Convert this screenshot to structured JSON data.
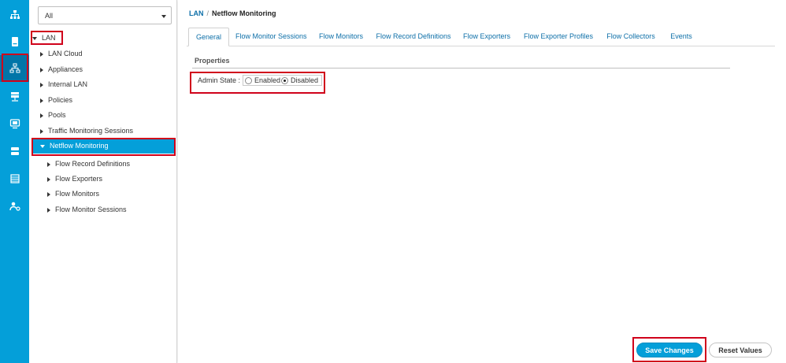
{
  "rail": {
    "icons": [
      "network-icon",
      "server-icon",
      "lan-icon",
      "san-icon",
      "vm-icon",
      "storage-icon",
      "chassis-icon",
      "admin-icon"
    ],
    "active": "lan-icon"
  },
  "tree": {
    "filter": {
      "value": "All"
    },
    "items": [
      {
        "label": "LAN",
        "arrow": "down"
      },
      {
        "label": "LAN Cloud",
        "arrow": "right"
      },
      {
        "label": "Appliances",
        "arrow": "right"
      },
      {
        "label": "Internal LAN",
        "arrow": "right"
      },
      {
        "label": "Policies",
        "arrow": "right"
      },
      {
        "label": "Pools",
        "arrow": "right"
      },
      {
        "label": "Traffic Monitoring Sessions",
        "arrow": "right"
      },
      {
        "label": "Netflow Monitoring",
        "arrow": "down",
        "selected": true
      },
      {
        "label": "Flow Record Definitions",
        "arrow": "right"
      },
      {
        "label": "Flow Exporters",
        "arrow": "right"
      },
      {
        "label": "Flow Monitors",
        "arrow": "right"
      },
      {
        "label": "Flow Monitor Sessions",
        "arrow": "right"
      }
    ]
  },
  "breadcrumb": {
    "root": "LAN",
    "separator": "/",
    "current": "Netflow Monitoring"
  },
  "tabs": [
    {
      "label": "General",
      "active": true
    },
    {
      "label": "Flow Monitor Sessions"
    },
    {
      "label": "Flow Monitors"
    },
    {
      "label": "Flow Record Definitions"
    },
    {
      "label": "Flow Exporters"
    },
    {
      "label": "Flow Exporter Profiles"
    },
    {
      "label": "Flow Collectors"
    },
    {
      "label": "Events"
    }
  ],
  "properties": {
    "title": "Properties",
    "admin_state": {
      "label": "Admin State :",
      "options": [
        "Enabled",
        "Disabled"
      ],
      "selected": "Disabled"
    }
  },
  "actions": {
    "save": "Save Changes",
    "reset": "Reset Values"
  },
  "colors": {
    "accent": "#049fd9",
    "rail_active": "#0175a8",
    "highlight": "#d0021b",
    "link": "#0d6fa8"
  }
}
